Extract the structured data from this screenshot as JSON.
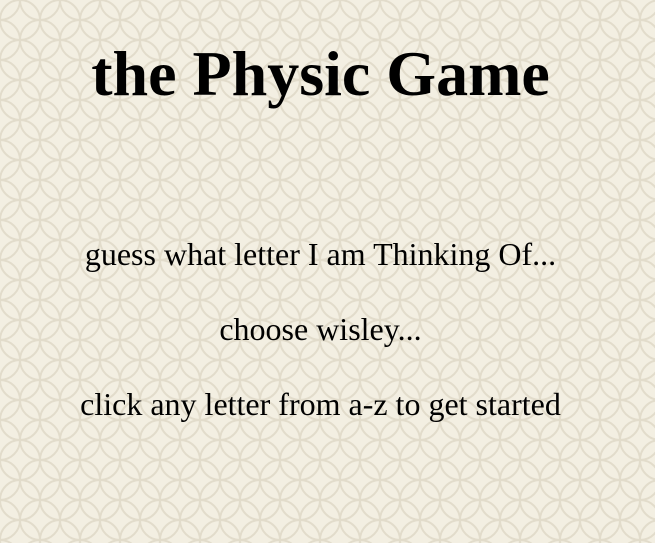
{
  "page": {
    "title": "the Physic Game",
    "instructions": [
      "guess what letter I am Thinking Of...",
      "choose wisley...",
      "click any letter from a-z to get started"
    ]
  },
  "colors": {
    "background": "#f3efe2",
    "pattern": "#e4dfcf",
    "text": "#000000"
  }
}
